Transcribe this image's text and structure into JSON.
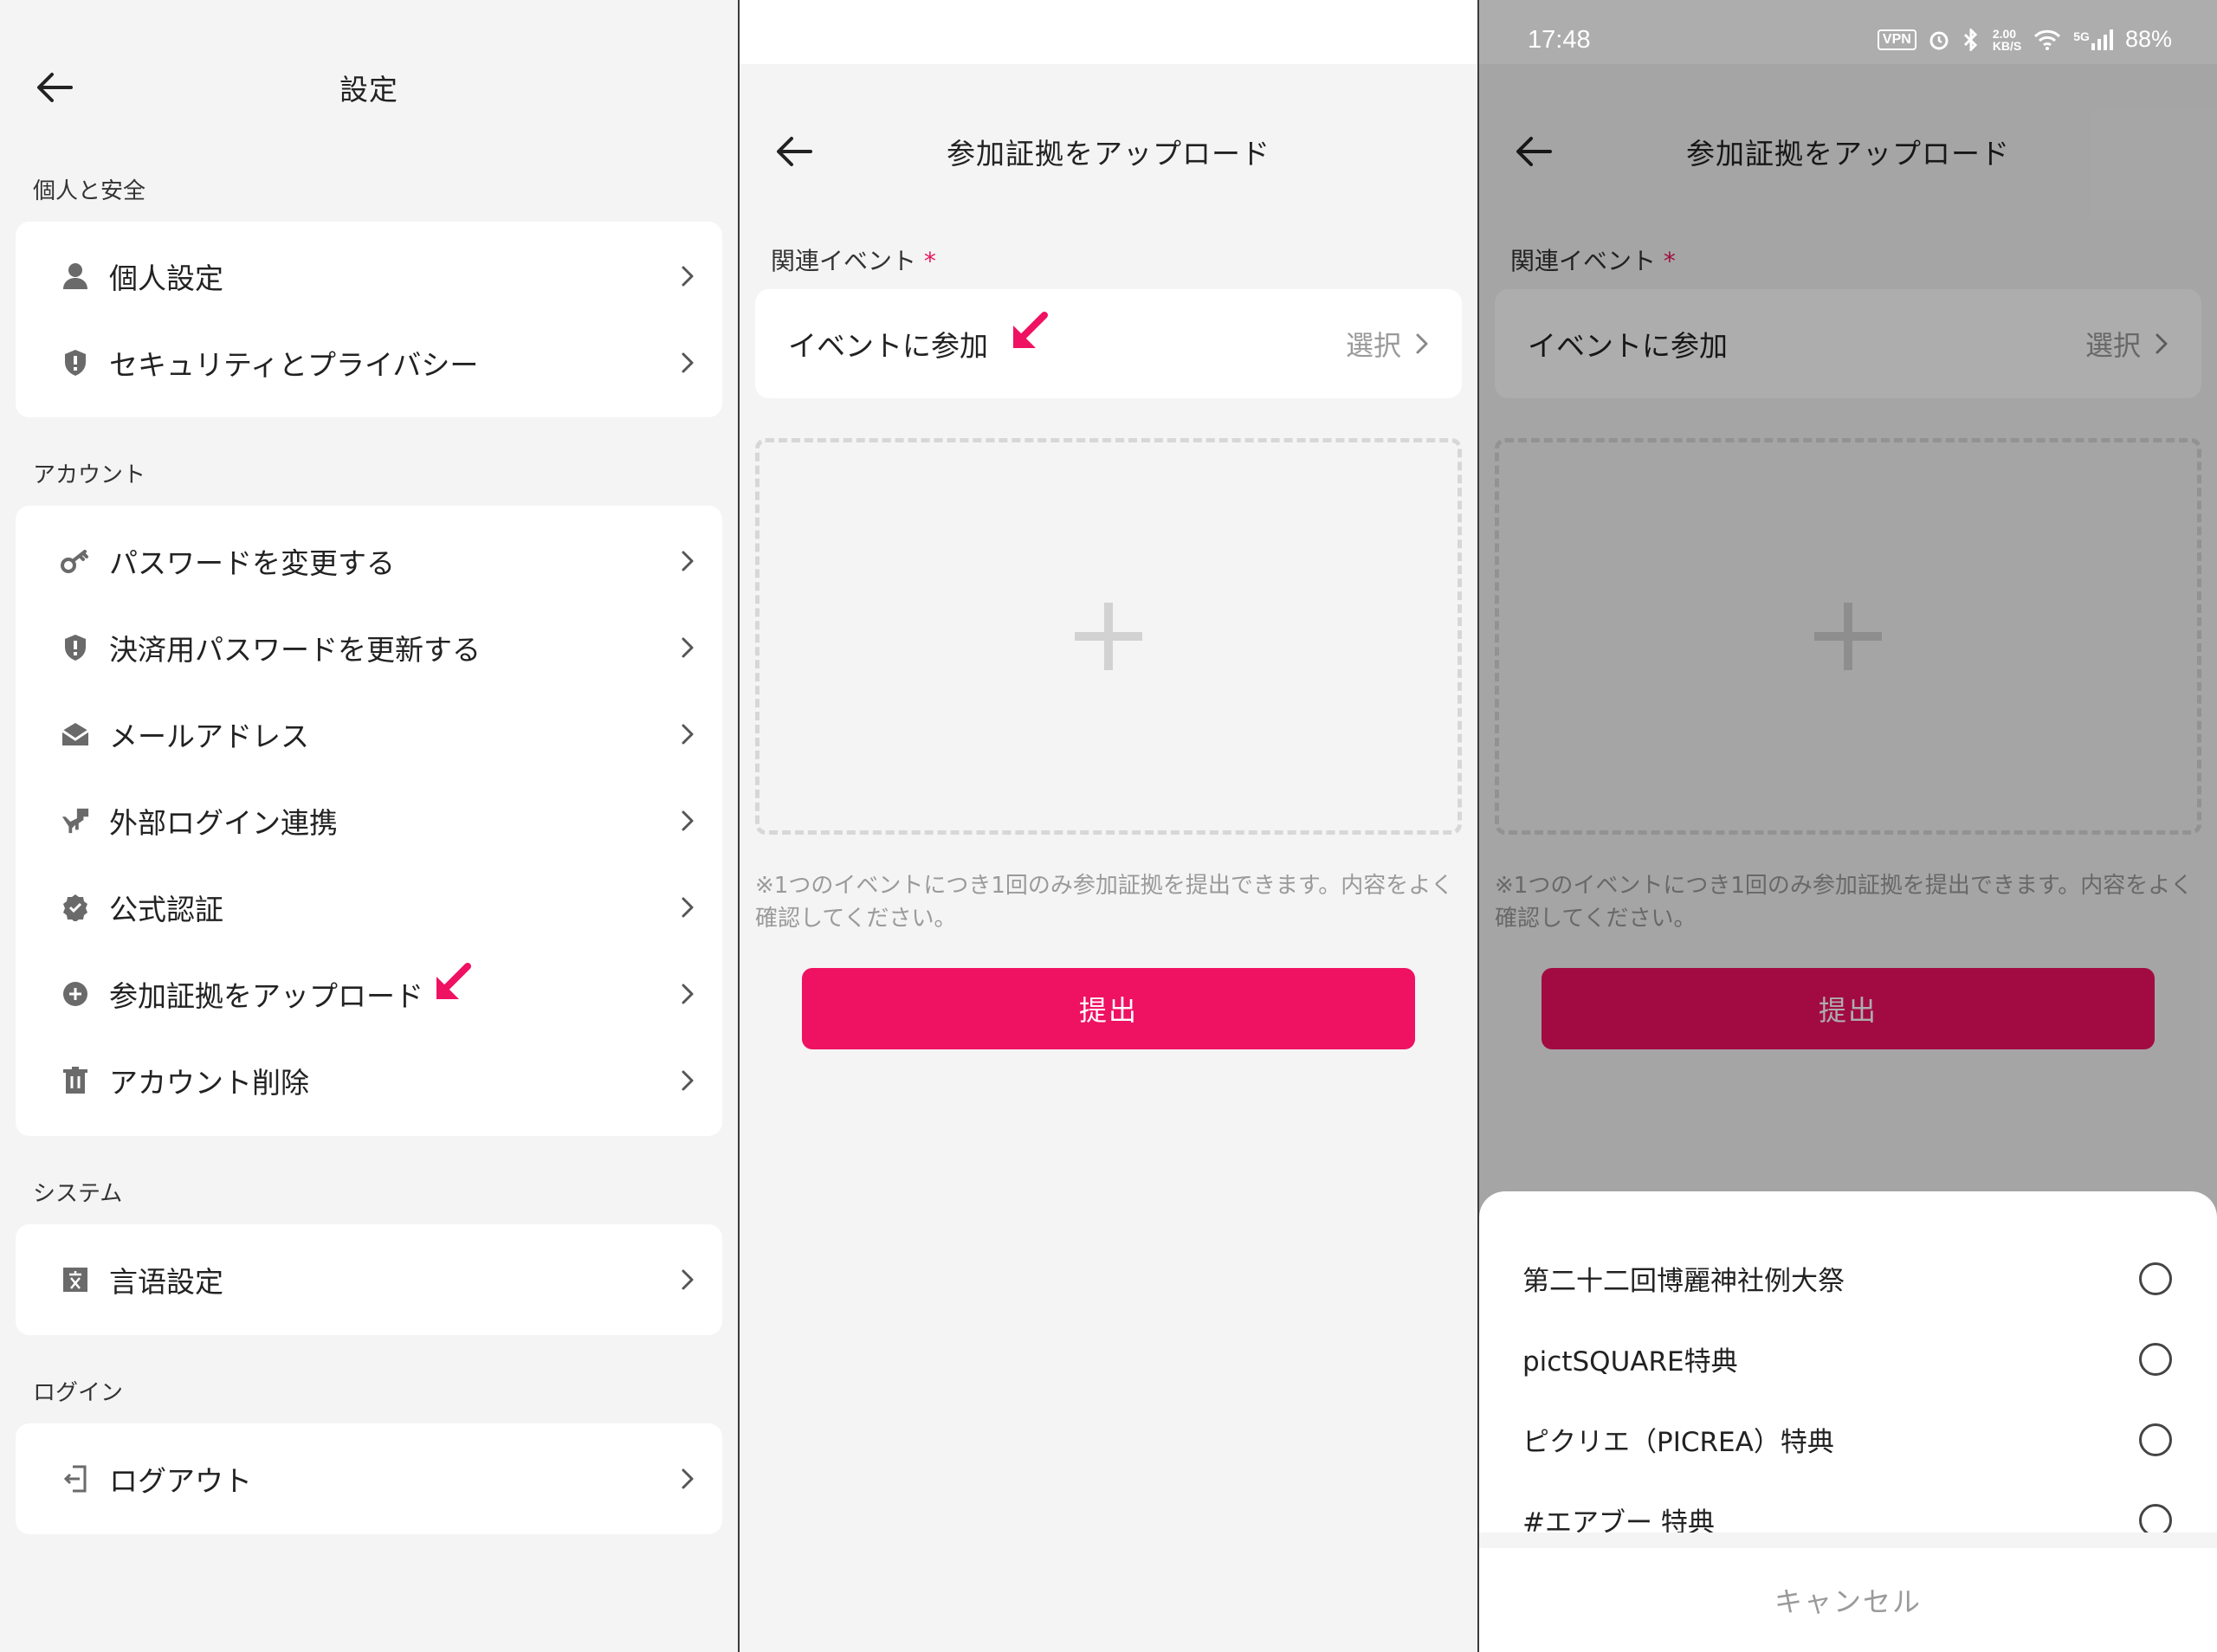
{
  "colors": {
    "accent": "#ef1162",
    "accent_dimmed": "#a80c45",
    "required": "#e8185a"
  },
  "status_bar": {
    "time": "17:48",
    "vpn": "VPN",
    "speed_top": "2.00",
    "speed_bottom": "KB/S",
    "network": "5G",
    "battery": "88%"
  },
  "settings": {
    "title": "設定",
    "sections": [
      {
        "label": "個人と安全",
        "items": [
          {
            "label": "個人設定",
            "icon": "person-icon"
          },
          {
            "label": "セキュリティとプライバシー",
            "icon": "shield-icon"
          }
        ]
      },
      {
        "label": "アカウント",
        "items": [
          {
            "label": "パスワードを変更する",
            "icon": "key-icon"
          },
          {
            "label": "決済用パスワードを更新する",
            "icon": "shield-icon"
          },
          {
            "label": "メールアドレス",
            "icon": "mail-icon"
          },
          {
            "label": "外部ログイン連携",
            "icon": "dinosaur-icon"
          },
          {
            "label": "公式認証",
            "icon": "verified-badge-icon"
          },
          {
            "label": "参加証拠をアップロード",
            "icon": "plus-circle-icon"
          },
          {
            "label": "アカウント削除",
            "icon": "trash-icon"
          }
        ]
      },
      {
        "label": "システム",
        "items": [
          {
            "label": "言语設定",
            "icon": "language-icon"
          }
        ]
      },
      {
        "label": "ログイン",
        "items": [
          {
            "label": "ログアウト",
            "icon": "logout-icon"
          }
        ]
      }
    ]
  },
  "upload": {
    "title": "参加証拠をアップロード",
    "field_label": "関連イベント",
    "required_mark": "*",
    "event_value": "イベントに参加",
    "select_label": "選択",
    "note": "※1つのイベントにつき1回のみ参加証拠を提出できます。内容をよく確認してください。",
    "submit_label": "提出"
  },
  "event_sheet": {
    "options": [
      "第二十二回博麗神社例大祭",
      "pictSQUARE特典",
      "ピクリエ（PICREA）特典",
      "#エアブー 特典"
    ],
    "cancel_label": "キャンセル"
  }
}
